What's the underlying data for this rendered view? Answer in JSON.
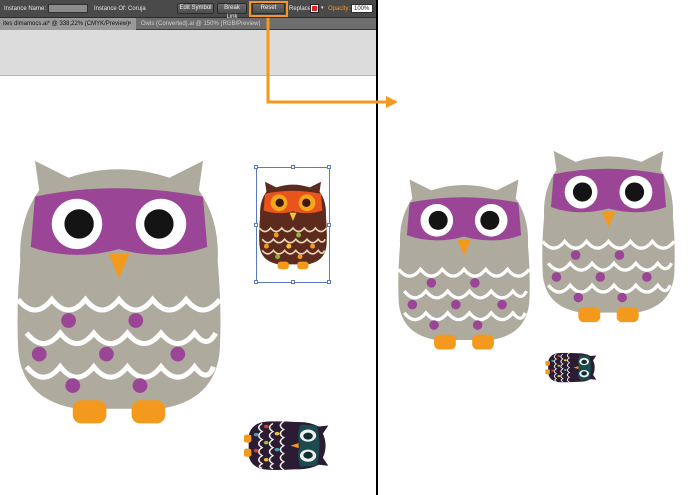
{
  "control_bar": {
    "instance_name_label": "Instance Name:",
    "instance_of_label": "Instance Of: Coruja",
    "edit_symbol_label": "Edit Symbol",
    "break_link_label": "Break Link",
    "reset_label": "Reset",
    "replace_label": "Replace:",
    "opacity_label": "Opacity:",
    "opacity_value": "100%"
  },
  "tabs": [
    {
      "label": "ites dimamocs.ai* @ 338,22% (CMYK/Preview)",
      "active": true
    },
    {
      "label": "Owls (Converted).ai @ 150% (RGB/Preview)",
      "active": false
    }
  ],
  "colors": {
    "highlight_orange": "#f39a1e",
    "gray_owl_body": "#aeaa9e",
    "gray_owl_mask": "#9b4596",
    "gray_owl_feet": "#f39a1e",
    "brown_owl_body": "#5d2b1e",
    "brown_owl_mask": "#e9531c",
    "dark_owl_body": "#2b1c33",
    "dark_owl_mask": "#1d4a4f"
  },
  "icons": {
    "tab_close": "close-icon",
    "dropdown": "chevron-down-icon"
  }
}
